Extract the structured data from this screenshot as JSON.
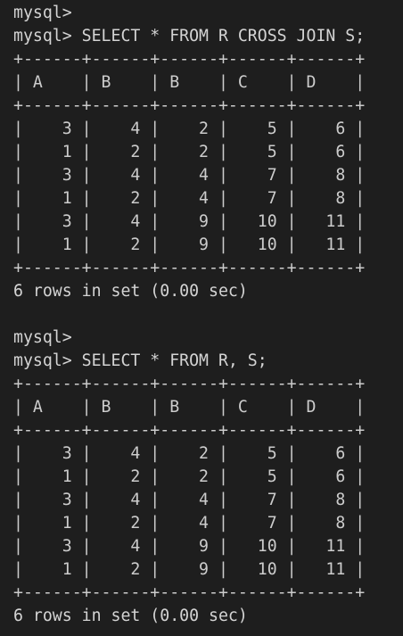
{
  "terminal": {
    "colors": {
      "background": "#1e1e1e",
      "text": "#d4d4d4"
    },
    "blocks": [
      {
        "lines": [
          {
            "text": "mysql>",
            "kind": "prompt"
          },
          {
            "text": "mysql> SELECT * FROM R CROSS JOIN S;",
            "kind": "command"
          },
          {
            "text": "+------+------+------+------+------+",
            "kind": "table"
          },
          {
            "text": "| A    | B    | B    | C    | D    |",
            "kind": "table"
          },
          {
            "text": "+------+------+------+------+------+",
            "kind": "table"
          },
          {
            "text": "|    3 |    4 |    2 |    5 |    6 |",
            "kind": "table"
          },
          {
            "text": "|    1 |    2 |    2 |    5 |    6 |",
            "kind": "table"
          },
          {
            "text": "|    3 |    4 |    4 |    7 |    8 |",
            "kind": "table"
          },
          {
            "text": "|    1 |    2 |    4 |    7 |    8 |",
            "kind": "table"
          },
          {
            "text": "|    3 |    4 |    9 |   10 |   11 |",
            "kind": "table"
          },
          {
            "text": "|    1 |    2 |    9 |   10 |   11 |",
            "kind": "table"
          },
          {
            "text": "+------+------+------+------+------+",
            "kind": "table"
          },
          {
            "text": "6 rows in set (0.00 sec)",
            "kind": "status"
          },
          {
            "text": "",
            "kind": "blank"
          }
        ]
      },
      {
        "lines": [
          {
            "text": "mysql>",
            "kind": "prompt"
          },
          {
            "text": "mysql> SELECT * FROM R, S;",
            "kind": "command"
          },
          {
            "text": "+------+------+------+------+------+",
            "kind": "table"
          },
          {
            "text": "| A    | B    | B    | C    | D    |",
            "kind": "table"
          },
          {
            "text": "+------+------+------+------+------+",
            "kind": "table"
          },
          {
            "text": "|    3 |    4 |    2 |    5 |    6 |",
            "kind": "table"
          },
          {
            "text": "|    1 |    2 |    2 |    5 |    6 |",
            "kind": "table"
          },
          {
            "text": "|    3 |    4 |    4 |    7 |    8 |",
            "kind": "table"
          },
          {
            "text": "|    1 |    2 |    4 |    7 |    8 |",
            "kind": "table"
          },
          {
            "text": "|    3 |    4 |    9 |   10 |   11 |",
            "kind": "table"
          },
          {
            "text": "|    1 |    2 |    9 |   10 |   11 |",
            "kind": "table"
          },
          {
            "text": "+------+------+------+------+------+",
            "kind": "table"
          },
          {
            "text": "6 rows in set (0.00 sec)",
            "kind": "status"
          }
        ]
      }
    ]
  }
}
